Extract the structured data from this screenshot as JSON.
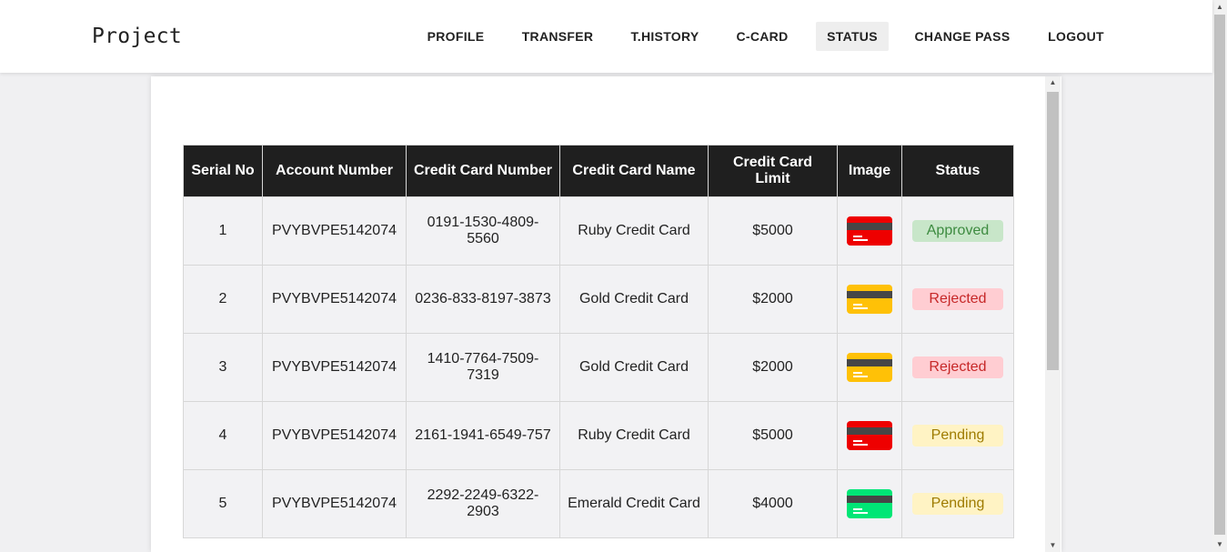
{
  "brand": "Project",
  "nav": [
    {
      "label": "PROFILE"
    },
    {
      "label": "TRANSFER"
    },
    {
      "label": "T.HISTORY"
    },
    {
      "label": "C-CARD"
    },
    {
      "label": "STATUS",
      "active": true
    },
    {
      "label": "CHANGE PASS"
    },
    {
      "label": "LOGOUT"
    }
  ],
  "table": {
    "headers": [
      "Serial No",
      "Account Number",
      "Credit Card Number",
      "Credit Card Name",
      "Credit Card Limit",
      "Image",
      "Status"
    ],
    "rows": [
      {
        "serial": "1",
        "account": "PVYBVPE5142074",
        "card_number": "0191-1530-4809-5560",
        "card_name": "Ruby Credit Card",
        "limit": "$5000",
        "image": "ruby-card-icon",
        "card_color": "#ee0000",
        "status": "Approved"
      },
      {
        "serial": "2",
        "account": "PVYBVPE5142074",
        "card_number": "0236-833-8197-3873",
        "card_name": "Gold Credit Card",
        "limit": "$2000",
        "image": "gold-card-icon",
        "card_color": "#ffc107",
        "status": "Rejected"
      },
      {
        "serial": "3",
        "account": "PVYBVPE5142074",
        "card_number": "1410-7764-7509-7319",
        "card_name": "Gold Credit Card",
        "limit": "$2000",
        "image": "gold-card-icon",
        "card_color": "#ffc107",
        "status": "Rejected"
      },
      {
        "serial": "4",
        "account": "PVYBVPE5142074",
        "card_number": "2161-1941-6549-757",
        "card_name": "Ruby Credit Card",
        "limit": "$5000",
        "image": "ruby-card-icon",
        "card_color": "#ee0000",
        "status": "Pending"
      },
      {
        "serial": "5",
        "account": "PVYBVPE5142074",
        "card_number": "2292-2249-6322-2903",
        "card_name": "Emerald Credit Card",
        "limit": "$4000",
        "image": "emerald-card-icon",
        "card_color": "#00e676",
        "status": "Pending"
      }
    ]
  },
  "status_colors": {
    "Approved": {
      "bg": "#c8e6c9",
      "fg": "#3d8b40"
    },
    "Rejected": {
      "bg": "#ffcdd2",
      "fg": "#c62828"
    },
    "Pending": {
      "bg": "#fff3c4",
      "fg": "#9e7b00"
    }
  }
}
